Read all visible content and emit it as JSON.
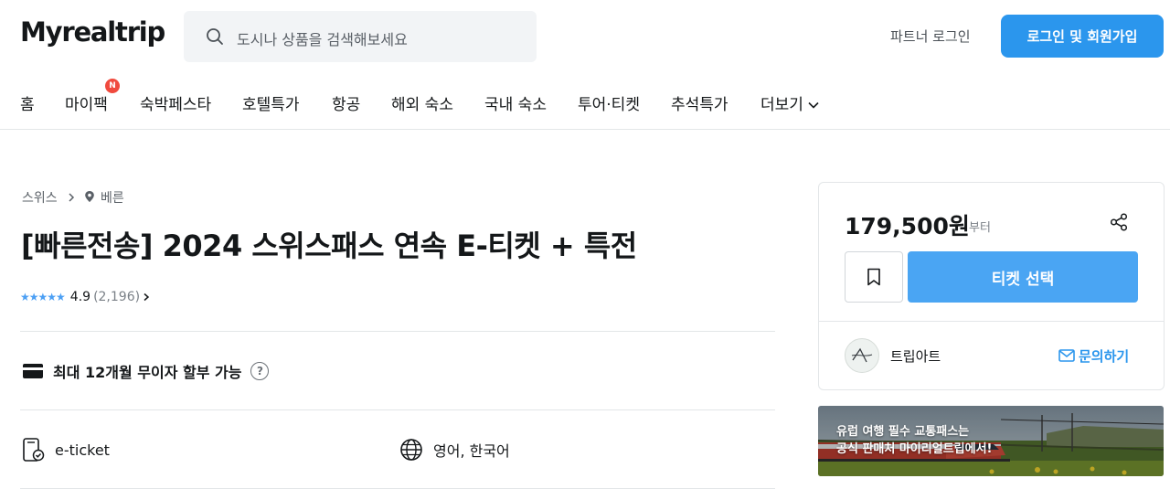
{
  "header": {
    "logo": "Myrealtrip",
    "search_placeholder": "도시나 상품을 검색해보세요",
    "partner_login": "파트너 로그인",
    "login_button": "로그인 및 회원가입"
  },
  "nav": {
    "items": [
      "홈",
      "마이팩",
      "숙박페스타",
      "호텔특가",
      "항공",
      "해외 숙소",
      "국내 숙소",
      "투어·티켓",
      "추석특가",
      "더보기"
    ],
    "badge": "N"
  },
  "breadcrumb": {
    "country": "스위스",
    "separator": ">",
    "city": "베른"
  },
  "product": {
    "title": "[빠른전송] 2024 스위스패스 연속 E-티켓 + 특전",
    "stars": "★★★★★",
    "rating": "4.9",
    "review_count": "(2,196)",
    "installment": "최대 12개월 무이자 할부 가능",
    "help": "?",
    "ticket_type": "e-ticket",
    "languages": "영어, 한국어"
  },
  "booking": {
    "price": "179,500원",
    "price_suffix": "부터",
    "ticket_button": "티켓 선택",
    "seller_name": "트립아트",
    "inquiry": "문의하기"
  },
  "banner": {
    "line1": "유럽 여행 필수 교통패스는",
    "line2": "공식 판매처 마이리얼트립에서!"
  },
  "colors": {
    "brand": "#2b96ed",
    "button": "#4aa5f3",
    "star": "#4b9ff4",
    "badge": "#f04a3e"
  }
}
